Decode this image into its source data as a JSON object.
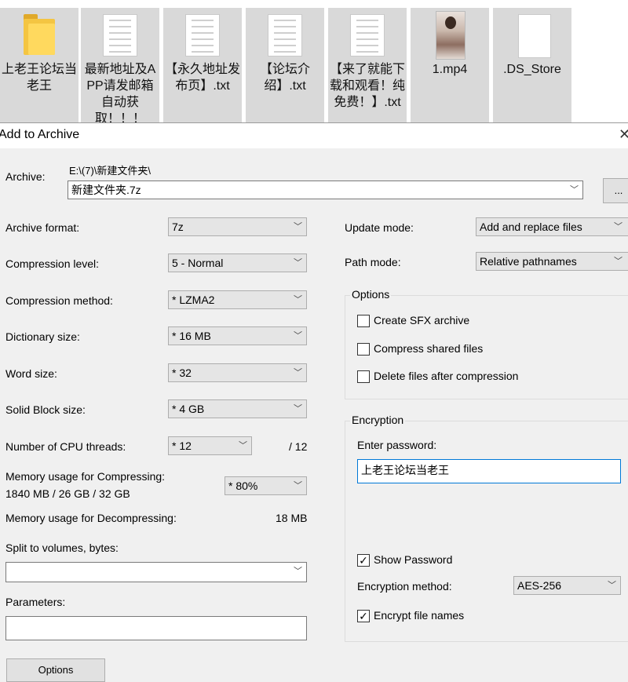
{
  "files": [
    {
      "name": "上老王论坛当老王",
      "icon": "folder-icon"
    },
    {
      "name": "最新地址及APP请发邮箱自动获取！！！",
      "icon": "text-file-icon"
    },
    {
      "name": "【永久地址发布页】.txt",
      "icon": "text-file-icon"
    },
    {
      "name": "【论坛介绍】.txt",
      "icon": "text-file-icon"
    },
    {
      "name": "【来了就能下载和观看！纯免费！】.txt",
      "icon": "text-file-icon"
    },
    {
      "name": "1.mp4",
      "icon": "video-thumbnail"
    },
    {
      "name": ".DS_Store",
      "icon": "blank-file-icon"
    }
  ],
  "dialog": {
    "title": "Add to Archive",
    "close": "✕",
    "archive_label": "Archive:",
    "archive_path": "E:\\(7)\\新建文件夹\\",
    "archive_name": "新建文件夹.7z",
    "browse_label": "...",
    "format_label": "Archive format:",
    "format_value": "7z",
    "level_label": "Compression level:",
    "level_value": "5 - Normal",
    "method_label": "Compression method:",
    "method_value": "* LZMA2",
    "dict_label": "Dictionary size:",
    "dict_value": "* 16 MB",
    "word_label": "Word size:",
    "word_value": "* 32",
    "solid_label": "Solid Block size:",
    "solid_value": "* 4 GB",
    "threads_label": "Number of CPU threads:",
    "threads_value": "* 12",
    "threads_max": "/ 12",
    "mem_comp_label": "Memory usage for Compressing:",
    "mem_comp_value": "1840 MB / 26 GB / 32 GB",
    "mem_comp_pct": "* 80%",
    "mem_decomp_label": "Memory usage for Decompressing:",
    "mem_decomp_value": "18 MB",
    "split_label": "Split to volumes, bytes:",
    "split_value": "",
    "params_label": "Parameters:",
    "params_value": "",
    "options_button": "Options",
    "update_label": "Update mode:",
    "update_value": "Add and replace files",
    "path_label": "Path mode:",
    "path_value": "Relative pathnames",
    "options_group": "Options",
    "opt_sfx": "Create SFX archive",
    "opt_shared": "Compress shared files",
    "opt_delete": "Delete files after compression",
    "encryption_group": "Encryption",
    "password_label": "Enter password:",
    "password_value": "上老王论坛当老王",
    "show_password": "Show Password",
    "enc_method_label": "Encryption method:",
    "enc_method_value": "AES-256",
    "encrypt_names": "Encrypt file names"
  },
  "checkboxes": {
    "sfx": false,
    "shared": false,
    "delete": false,
    "show_password": true,
    "encrypt_names": true
  }
}
